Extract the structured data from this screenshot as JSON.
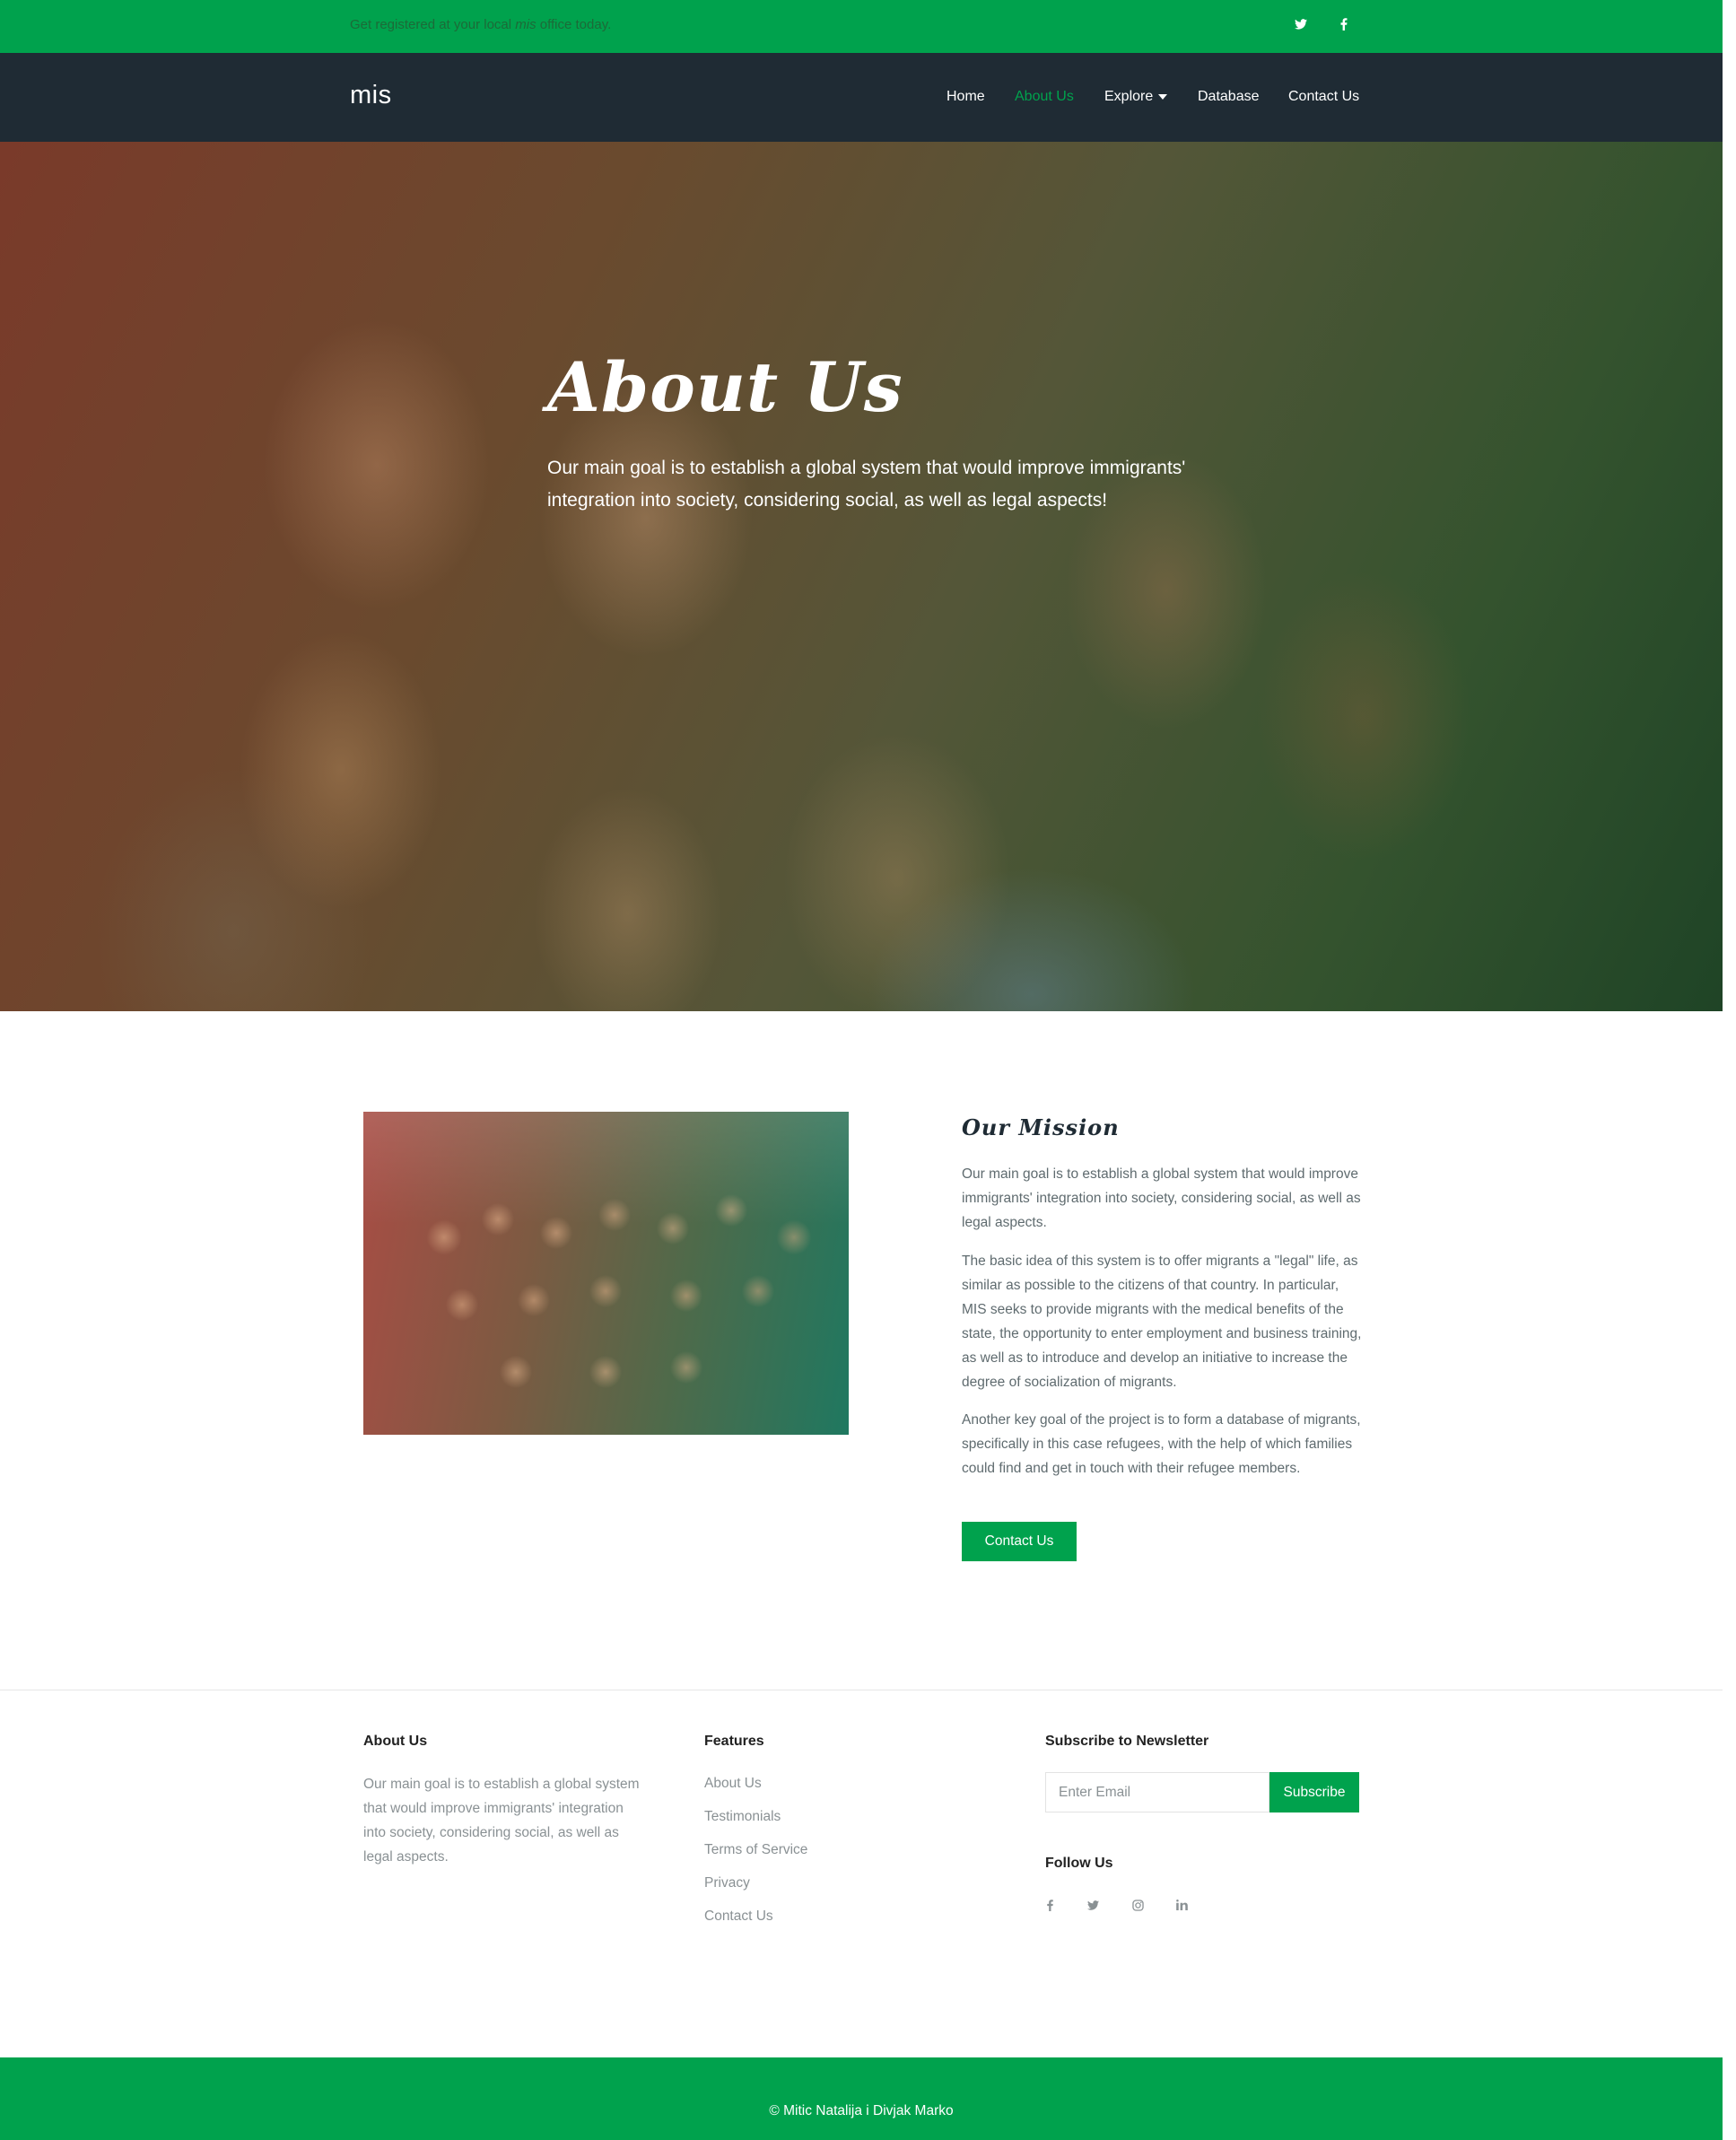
{
  "topbar": {
    "text_before": "Get registered at your local ",
    "text_emph": "mis",
    "text_after": " office today."
  },
  "navbar": {
    "brand": "mis",
    "links": [
      {
        "label": "Home"
      },
      {
        "label": "About Us",
        "active": true
      },
      {
        "label": "Explore"
      },
      {
        "label": "Database"
      },
      {
        "label": "Contact Us"
      }
    ]
  },
  "hero": {
    "title": "About Us",
    "text": "Our main goal is to establish a global system that would improve immigrants' integration into society, considering social, as well as legal aspects!"
  },
  "mission": {
    "title": "Our Mission",
    "paragraphs": [
      "Our main goal is to establish a global system that would improve immigrants' integration into society, considering social, as well as legal aspects.",
      "The basic idea of this system is to offer migrants a \"legal\" life, as similar as possible to the citizens of that country. In particular, MIS seeks to provide migrants with the medical benefits of the state, the opportunity to enter employment and business training, as well as to introduce and develop an initiative to increase the degree of socialization of migrants.",
      "Another key goal of the project is to form a database of migrants, specifically in this case refugees, with the help of which families could find and get in touch with their refugee members."
    ],
    "button": "Contact Us"
  },
  "footer": {
    "about": {
      "heading": "About Us",
      "text": "Our main goal is to establish a global system that would improve immigrants' integration into society, considering social, as well as legal aspects."
    },
    "features": {
      "heading": "Features",
      "links": [
        "About Us",
        "Testimonials",
        "Terms of Service",
        "Privacy",
        "Contact Us"
      ]
    },
    "newsletter": {
      "heading": "Subscribe to Newsletter",
      "placeholder": "Enter Email",
      "button": "Subscribe"
    },
    "follow": {
      "heading": "Follow Us",
      "icons": [
        "facebook-icon",
        "twitter-icon",
        "instagram-icon",
        "linkedin-icon"
      ]
    },
    "copyright": "© Mitic Natalija i Divjak Marko"
  },
  "colors": {
    "accent": "#00a24d",
    "navbar": "#1f2b34",
    "text": "#5f6b6f"
  }
}
